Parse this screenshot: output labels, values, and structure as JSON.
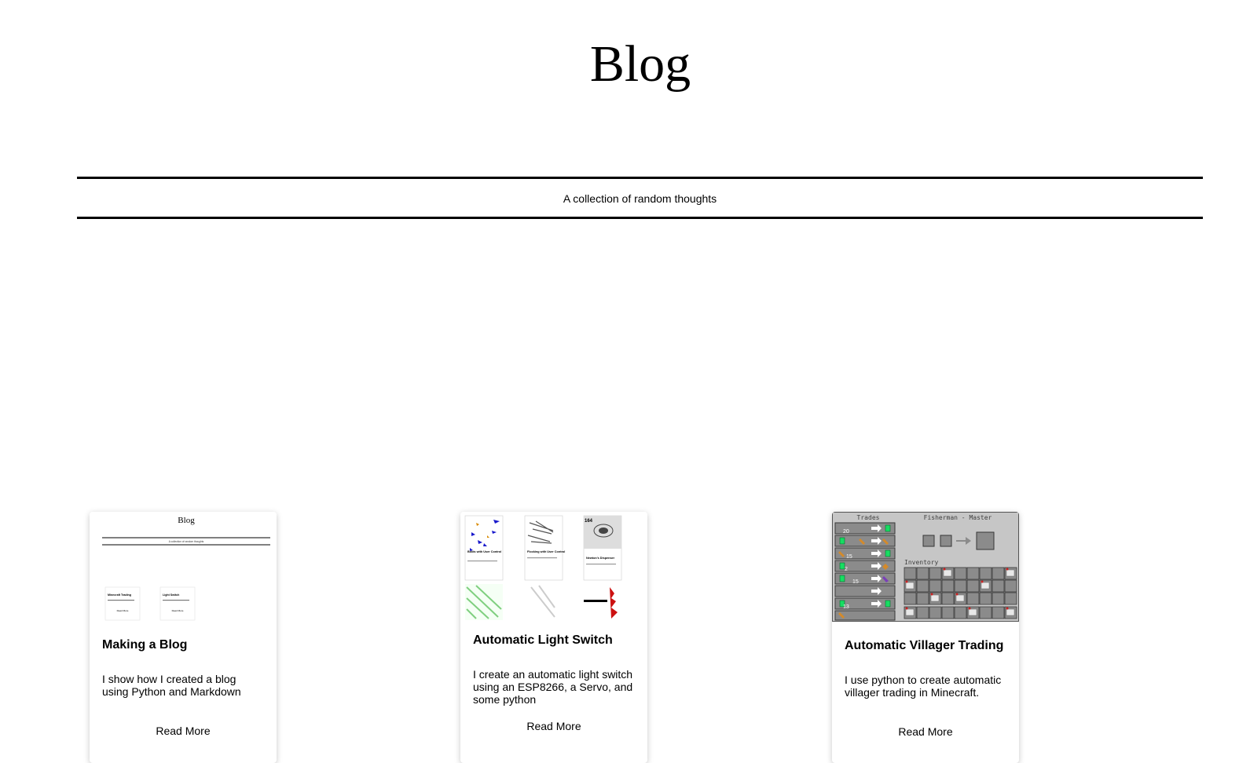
{
  "header": {
    "title": "Blog",
    "tagline": "A collection of random thoughts"
  },
  "posts": [
    {
      "title": "Making a Blog",
      "description": "I show how I created a blog using Python and Markdown",
      "read_more": "Read More",
      "thumbnail": {
        "kind": "screenshot-of-blog",
        "title": "Blog",
        "tagline": "A collection of random thoughts",
        "cards": [
          {
            "title": "Minecraft Trading",
            "read_more": "Read More"
          },
          {
            "title": "Light Switch",
            "read_more": "Read More"
          }
        ]
      }
    },
    {
      "title": "Automatic Light Switch",
      "description": "I create an automatic light switch using an ESP8266, a Servo, and some python",
      "read_more": "Read More",
      "thumbnail": {
        "kind": "screenshot-of-projects",
        "badge": "164",
        "cards": [
          {
            "title": "Boids with User Control"
          },
          {
            "title": "Flocking with User Control"
          },
          {
            "title": "Newton's Dispenser"
          }
        ]
      }
    },
    {
      "title": "Automatic Villager Trading",
      "description": "I use python to create automatic villager trading in Minecraft.",
      "read_more": "Read More",
      "thumbnail": {
        "kind": "minecraft-trading-screen",
        "trades_label": "Trades",
        "villager_label": "Fisherman - Master",
        "inventory_label": "Inventory",
        "trade_counts": [
          "20",
          "",
          "15",
          "2",
          "15",
          "13",
          ""
        ],
        "colors": {
          "panel": "#c6c6c6",
          "slot": "#8b8b8b",
          "emerald": "#17dd62"
        }
      }
    }
  ]
}
